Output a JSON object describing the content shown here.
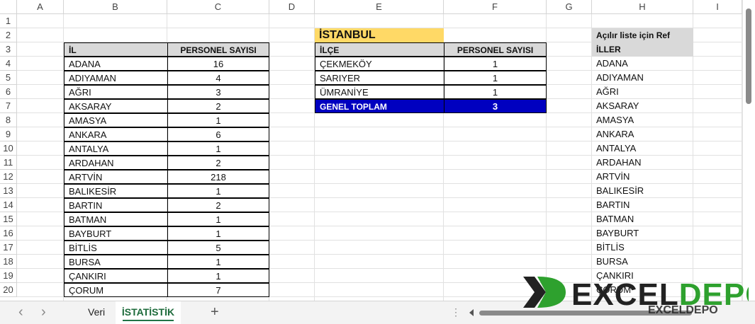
{
  "columns": [
    "A",
    "B",
    "C",
    "D",
    "E",
    "F",
    "G",
    "H",
    "I"
  ],
  "rows": [
    "1",
    "2",
    "3",
    "4",
    "5",
    "6",
    "7",
    "8",
    "9",
    "10",
    "11",
    "12",
    "13",
    "14",
    "15",
    "16",
    "17",
    "18",
    "19",
    "20"
  ],
  "main_table": {
    "headers": [
      "İL",
      "PERSONEL SAYISI"
    ],
    "rows": [
      [
        "ADANA",
        "16"
      ],
      [
        "ADIYAMAN",
        "4"
      ],
      [
        "AĞRI",
        "3"
      ],
      [
        "AKSARAY",
        "2"
      ],
      [
        "AMASYA",
        "1"
      ],
      [
        "ANKARA",
        "6"
      ],
      [
        "ANTALYA",
        "1"
      ],
      [
        "ARDAHAN",
        "2"
      ],
      [
        "ARTVİN",
        "218"
      ],
      [
        "BALIKESİR",
        "1"
      ],
      [
        "BARTIN",
        "2"
      ],
      [
        "BATMAN",
        "1"
      ],
      [
        "BAYBURT",
        "1"
      ],
      [
        "BİTLİS",
        "5"
      ],
      [
        "BURSA",
        "1"
      ],
      [
        "ÇANKIRI",
        "1"
      ],
      [
        "ÇORUM",
        "7"
      ]
    ]
  },
  "filter": {
    "selected_city": "İSTANBUL",
    "headers": [
      "İLÇE",
      "PERSONEL SAYISI"
    ],
    "rows": [
      [
        "ÇEKMEKÖY",
        "1"
      ],
      [
        "SARIYER",
        "1"
      ],
      [
        "ÜMRANİYE",
        "1"
      ]
    ],
    "total_label": "GENEL TOPLAM",
    "total_value": "3"
  },
  "ref_list": {
    "title": "Açılır liste için Ref",
    "header": "İLLER",
    "items": [
      "ADANA",
      "ADIYAMAN",
      "AĞRI",
      "AKSARAY",
      "AMASYA",
      "ANKARA",
      "ANTALYA",
      "ARDAHAN",
      "ARTVİN",
      "BALIKESİR",
      "BARTIN",
      "BATMAN",
      "BAYBURT",
      "BİTLİS",
      "BURSA",
      "ÇANKIRI",
      "ÇORUM"
    ]
  },
  "tabs": {
    "prev_glyph": "‹",
    "next_glyph": "›",
    "sheet1": "Veri",
    "sheet2": "İSTATİSTİK",
    "add_glyph": "+",
    "more_glyph": "⋮"
  },
  "watermark": {
    "logo_text": "EXCELDEPO",
    "logo_part1": "EXCEL",
    "logo_part2": "DEPO",
    "logo_x": "X"
  },
  "colors": {
    "city_highlight": "#ffd966",
    "total_fill": "#0000c0",
    "header_fill": "#d9d9d9",
    "active_tab_underline": "#217346",
    "logo_green": "#2ea12e"
  }
}
